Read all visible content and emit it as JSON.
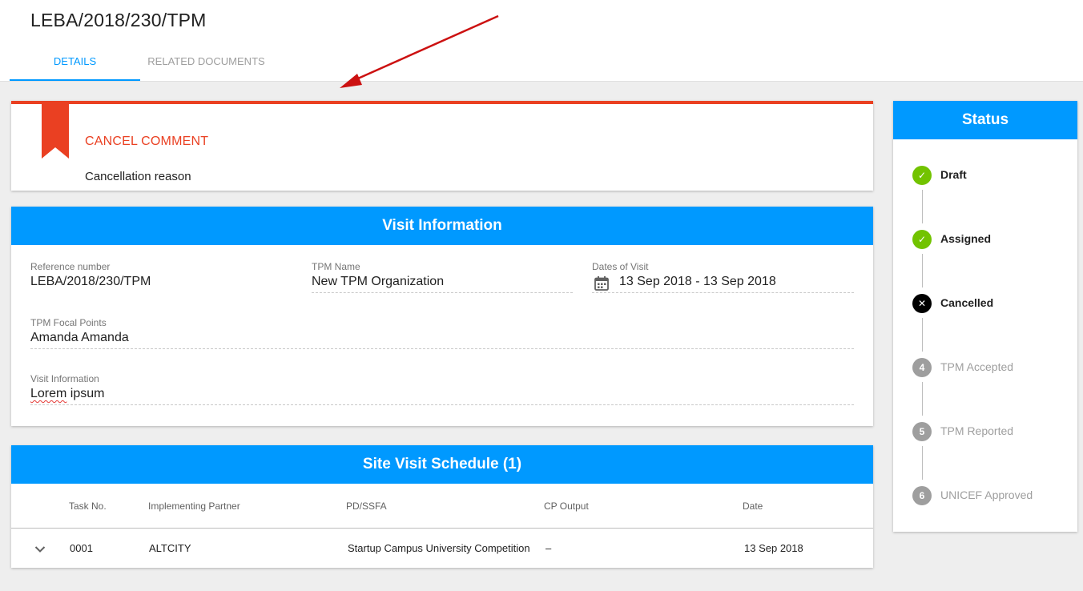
{
  "header": {
    "title": "LEBA/2018/230/TPM",
    "tabs": [
      {
        "label": "DETAILS",
        "active": true
      },
      {
        "label": "RELATED DOCUMENTS",
        "active": false
      }
    ]
  },
  "cancel_comment": {
    "heading": "CANCEL COMMENT",
    "text": "Cancellation reason"
  },
  "visit_information": {
    "header": "Visit Information",
    "reference_number": {
      "label": "Reference number",
      "value": "LEBA/2018/230/TPM"
    },
    "tpm_name": {
      "label": "TPM Name",
      "value": "New TPM Organization"
    },
    "dates_of_visit": {
      "label": "Dates of Visit",
      "value": "13 Sep 2018 - 13 Sep 2018",
      "icon": "calendar-icon"
    },
    "tpm_focal_points": {
      "label": "TPM Focal Points",
      "value": "Amanda Amanda"
    },
    "visit_information": {
      "label": "Visit Information",
      "value_word1": "Lorem",
      "value_word2": " ipsum"
    }
  },
  "site_visit_schedule": {
    "header": "Site Visit Schedule (1)",
    "columns": [
      "Task No.",
      "Implementing Partner",
      "PD/SSFA",
      "CP Output",
      "Date"
    ],
    "rows": [
      {
        "task_no": "0001",
        "implementing_partner": "ALTCITY",
        "pd_ssfa": "Startup Campus University Competition",
        "cp_output": "–",
        "date": "13 Sep 2018"
      }
    ]
  },
  "status": {
    "header": "Status",
    "steps": [
      {
        "label": "Draft",
        "state": "done",
        "marker": "✓"
      },
      {
        "label": "Assigned",
        "state": "done",
        "marker": "✓"
      },
      {
        "label": "Cancelled",
        "state": "cancelled",
        "marker": "✕"
      },
      {
        "label": "TPM Accepted",
        "state": "pending",
        "marker": "4"
      },
      {
        "label": "TPM Reported",
        "state": "pending",
        "marker": "5"
      },
      {
        "label": "UNICEF Approved",
        "state": "pending",
        "marker": "6"
      }
    ]
  },
  "colors": {
    "primary": "#0099ff",
    "cancel_accent": "#ea4022",
    "done_green": "#72c300",
    "pending_grey": "#9e9e9e",
    "annotation_arrow": "#cc1111"
  }
}
